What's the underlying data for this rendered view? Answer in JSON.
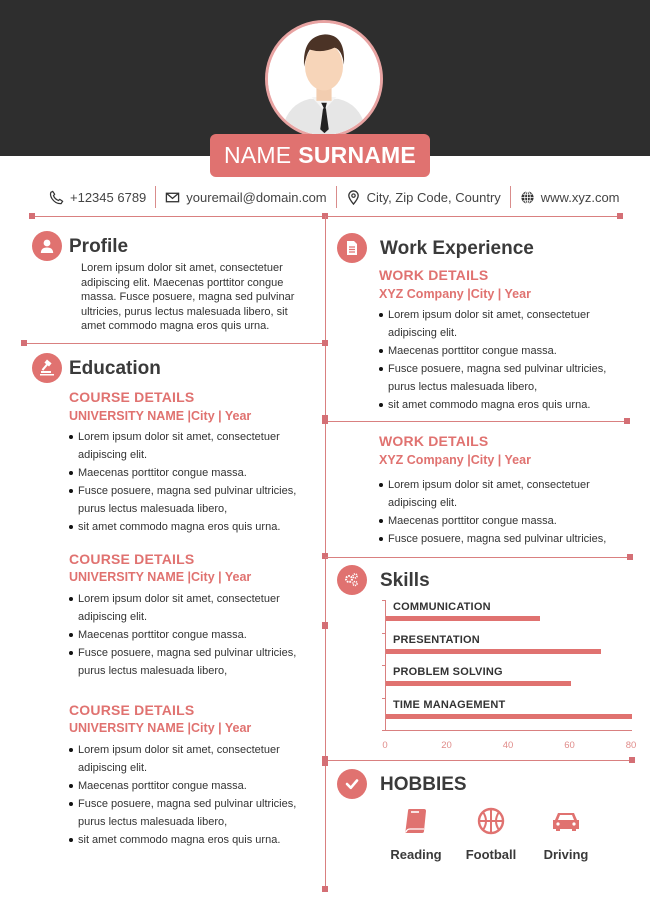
{
  "header": {
    "name_first": "NAME",
    "name_last": "SURNAME",
    "avatar_icon": "person-avatar-icon"
  },
  "contact": [
    {
      "icon": "phone-icon",
      "text": "+12345 6789"
    },
    {
      "icon": "email-icon",
      "text": "youremail@domain.com"
    },
    {
      "icon": "location-pin-icon",
      "text": "City, Zip Code, Country"
    },
    {
      "icon": "globe-icon",
      "text": "www.xyz.com"
    }
  ],
  "profile": {
    "title": "Profile",
    "icon": "user-icon",
    "text": "Lorem ipsum dolor sit amet, consectetuer adipiscing elit. Maecenas porttitor congue massa. Fusce posuere, magna sed pulvinar ultricies, purus lectus malesuada libero, sit amet commodo magna eros quis urna."
  },
  "education": {
    "title": "Education",
    "icon": "gavel-icon",
    "entries": [
      {
        "course": "COURSE DETAILS",
        "school": "UNIVERSITY NAME |City | Year",
        "bullets": [
          "Lorem ipsum dolor sit amet, consectetuer adipiscing elit.",
          "Maecenas porttitor congue massa.",
          "Fusce posuere, magna sed pulvinar ultricies, purus lectus malesuada libero,",
          "sit amet commodo magna eros quis urna."
        ]
      },
      {
        "course": "COURSE DETAILS",
        "school": "UNIVERSITY NAME |City | Year",
        "bullets": [
          "Lorem ipsum dolor sit amet, consectetuer adipiscing elit.",
          "Maecenas porttitor congue massa.",
          "Fusce posuere, magna sed pulvinar ultricies, purus lectus malesuada libero,"
        ]
      },
      {
        "course": "COURSE DETAILS",
        "school": "UNIVERSITY NAME |City | Year",
        "bullets": [
          "Lorem ipsum dolor sit amet, consectetuer adipiscing elit.",
          "Maecenas porttitor congue massa.",
          "Fusce posuere, magna sed pulvinar ultricies, purus lectus malesuada libero,",
          "sit amet commodo magna eros quis urna."
        ]
      }
    ]
  },
  "work": {
    "title": "Work Experience",
    "icon": "document-icon",
    "entries": [
      {
        "role": "WORK DETAILS",
        "company": "XYZ Company |City | Year",
        "bullets": [
          "Lorem ipsum dolor sit amet, consectetuer adipiscing elit.",
          "Maecenas porttitor congue massa.",
          "Fusce posuere, magna sed pulvinar ultricies, purus lectus malesuada libero,",
          "sit amet commodo magna eros quis urna."
        ]
      },
      {
        "role": "WORK DETAILS",
        "company": "XYZ Company |City | Year",
        "bullets": [
          "Lorem ipsum dolor sit amet, consectetuer adipiscing elit.",
          "Maecenas porttitor congue massa.",
          "Fusce posuere, magna sed pulvinar ultricies,"
        ]
      }
    ]
  },
  "skills": {
    "title": "Skills",
    "icon": "gears-icon"
  },
  "chart_data": {
    "type": "bar",
    "orientation": "horizontal",
    "title": "Skills",
    "categories": [
      "COMMUNICATION",
      "PRESENTATION",
      "PROBLEM SOLVING",
      "TIME MANAGEMENT"
    ],
    "values": [
      50,
      70,
      60,
      80
    ],
    "xticks": [
      "0",
      "20",
      "40",
      "60",
      "80"
    ],
    "xlim": [
      0,
      80
    ],
    "xlabel": "",
    "ylabel": "",
    "grid": false,
    "legend": "none"
  },
  "hobbies": {
    "title": "HOBBIES",
    "icon": "checkmark-icon",
    "items": [
      {
        "icon": "book-icon",
        "label": "Reading"
      },
      {
        "icon": "ball-icon",
        "label": "Football"
      },
      {
        "icon": "car-icon",
        "label": "Driving"
      }
    ]
  },
  "colors": {
    "accent": "#e07270",
    "header_band": "#2e2e2e",
    "divider": "#d98080",
    "heading_text": "#3a3a3a"
  }
}
